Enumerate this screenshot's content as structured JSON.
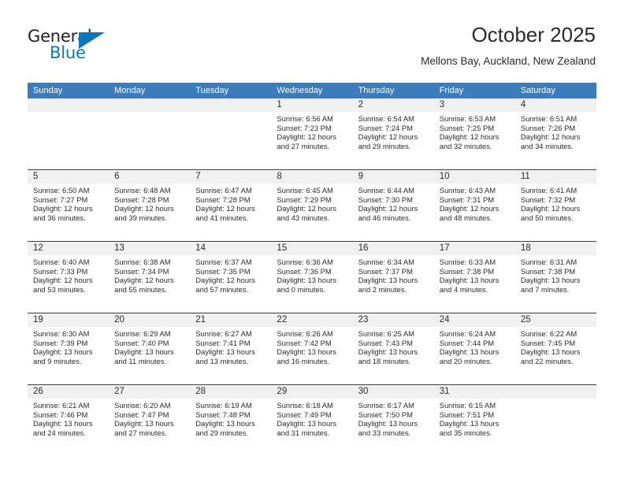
{
  "logo": {
    "primary_text": "General",
    "secondary_text": "Blue",
    "accent_color": "#1175bc"
  },
  "header": {
    "title": "October 2025",
    "subtitle": "Mellons Bay, Auckland, New Zealand"
  },
  "theme": {
    "header_row_color": "#3d7cba",
    "day_band_color": "#f0f0f0",
    "text_color": "#2b2b2b"
  },
  "calendar": {
    "weekdays": [
      "Sunday",
      "Monday",
      "Tuesday",
      "Wednesday",
      "Thursday",
      "Friday",
      "Saturday"
    ],
    "weeks": [
      [
        {
          "day": "",
          "empty": true
        },
        {
          "day": "",
          "empty": true
        },
        {
          "day": "",
          "empty": true
        },
        {
          "day": "1",
          "sunrise": "Sunrise: 6:56 AM",
          "sunset": "Sunset: 7:23 PM",
          "daylight_1": "Daylight: 12 hours",
          "daylight_2": "and 27 minutes."
        },
        {
          "day": "2",
          "sunrise": "Sunrise: 6:54 AM",
          "sunset": "Sunset: 7:24 PM",
          "daylight_1": "Daylight: 12 hours",
          "daylight_2": "and 29 minutes."
        },
        {
          "day": "3",
          "sunrise": "Sunrise: 6:53 AM",
          "sunset": "Sunset: 7:25 PM",
          "daylight_1": "Daylight: 12 hours",
          "daylight_2": "and 32 minutes."
        },
        {
          "day": "4",
          "sunrise": "Sunrise: 6:51 AM",
          "sunset": "Sunset: 7:26 PM",
          "daylight_1": "Daylight: 12 hours",
          "daylight_2": "and 34 minutes."
        }
      ],
      [
        {
          "day": "5",
          "sunrise": "Sunrise: 6:50 AM",
          "sunset": "Sunset: 7:27 PM",
          "daylight_1": "Daylight: 12 hours",
          "daylight_2": "and 36 minutes."
        },
        {
          "day": "6",
          "sunrise": "Sunrise: 6:48 AM",
          "sunset": "Sunset: 7:28 PM",
          "daylight_1": "Daylight: 12 hours",
          "daylight_2": "and 39 minutes."
        },
        {
          "day": "7",
          "sunrise": "Sunrise: 6:47 AM",
          "sunset": "Sunset: 7:28 PM",
          "daylight_1": "Daylight: 12 hours",
          "daylight_2": "and 41 minutes."
        },
        {
          "day": "8",
          "sunrise": "Sunrise: 6:45 AM",
          "sunset": "Sunset: 7:29 PM",
          "daylight_1": "Daylight: 12 hours",
          "daylight_2": "and 43 minutes."
        },
        {
          "day": "9",
          "sunrise": "Sunrise: 6:44 AM",
          "sunset": "Sunset: 7:30 PM",
          "daylight_1": "Daylight: 12 hours",
          "daylight_2": "and 46 minutes."
        },
        {
          "day": "10",
          "sunrise": "Sunrise: 6:43 AM",
          "sunset": "Sunset: 7:31 PM",
          "daylight_1": "Daylight: 12 hours",
          "daylight_2": "and 48 minutes."
        },
        {
          "day": "11",
          "sunrise": "Sunrise: 6:41 AM",
          "sunset": "Sunset: 7:32 PM",
          "daylight_1": "Daylight: 12 hours",
          "daylight_2": "and 50 minutes."
        }
      ],
      [
        {
          "day": "12",
          "sunrise": "Sunrise: 6:40 AM",
          "sunset": "Sunset: 7:33 PM",
          "daylight_1": "Daylight: 12 hours",
          "daylight_2": "and 53 minutes."
        },
        {
          "day": "13",
          "sunrise": "Sunrise: 6:38 AM",
          "sunset": "Sunset: 7:34 PM",
          "daylight_1": "Daylight: 12 hours",
          "daylight_2": "and 55 minutes."
        },
        {
          "day": "14",
          "sunrise": "Sunrise: 6:37 AM",
          "sunset": "Sunset: 7:35 PM",
          "daylight_1": "Daylight: 12 hours",
          "daylight_2": "and 57 minutes."
        },
        {
          "day": "15",
          "sunrise": "Sunrise: 6:36 AM",
          "sunset": "Sunset: 7:36 PM",
          "daylight_1": "Daylight: 13 hours",
          "daylight_2": "and 0 minutes."
        },
        {
          "day": "16",
          "sunrise": "Sunrise: 6:34 AM",
          "sunset": "Sunset: 7:37 PM",
          "daylight_1": "Daylight: 13 hours",
          "daylight_2": "and 2 minutes."
        },
        {
          "day": "17",
          "sunrise": "Sunrise: 6:33 AM",
          "sunset": "Sunset: 7:38 PM",
          "daylight_1": "Daylight: 13 hours",
          "daylight_2": "and 4 minutes."
        },
        {
          "day": "18",
          "sunrise": "Sunrise: 6:31 AM",
          "sunset": "Sunset: 7:38 PM",
          "daylight_1": "Daylight: 13 hours",
          "daylight_2": "and 7 minutes."
        }
      ],
      [
        {
          "day": "19",
          "sunrise": "Sunrise: 6:30 AM",
          "sunset": "Sunset: 7:39 PM",
          "daylight_1": "Daylight: 13 hours",
          "daylight_2": "and 9 minutes."
        },
        {
          "day": "20",
          "sunrise": "Sunrise: 6:29 AM",
          "sunset": "Sunset: 7:40 PM",
          "daylight_1": "Daylight: 13 hours",
          "daylight_2": "and 11 minutes."
        },
        {
          "day": "21",
          "sunrise": "Sunrise: 6:27 AM",
          "sunset": "Sunset: 7:41 PM",
          "daylight_1": "Daylight: 13 hours",
          "daylight_2": "and 13 minutes."
        },
        {
          "day": "22",
          "sunrise": "Sunrise: 6:26 AM",
          "sunset": "Sunset: 7:42 PM",
          "daylight_1": "Daylight: 13 hours",
          "daylight_2": "and 16 minutes."
        },
        {
          "day": "23",
          "sunrise": "Sunrise: 6:25 AM",
          "sunset": "Sunset: 7:43 PM",
          "daylight_1": "Daylight: 13 hours",
          "daylight_2": "and 18 minutes."
        },
        {
          "day": "24",
          "sunrise": "Sunrise: 6:24 AM",
          "sunset": "Sunset: 7:44 PM",
          "daylight_1": "Daylight: 13 hours",
          "daylight_2": "and 20 minutes."
        },
        {
          "day": "25",
          "sunrise": "Sunrise: 6:22 AM",
          "sunset": "Sunset: 7:45 PM",
          "daylight_1": "Daylight: 13 hours",
          "daylight_2": "and 22 minutes."
        }
      ],
      [
        {
          "day": "26",
          "sunrise": "Sunrise: 6:21 AM",
          "sunset": "Sunset: 7:46 PM",
          "daylight_1": "Daylight: 13 hours",
          "daylight_2": "and 24 minutes."
        },
        {
          "day": "27",
          "sunrise": "Sunrise: 6:20 AM",
          "sunset": "Sunset: 7:47 PM",
          "daylight_1": "Daylight: 13 hours",
          "daylight_2": "and 27 minutes."
        },
        {
          "day": "28",
          "sunrise": "Sunrise: 6:19 AM",
          "sunset": "Sunset: 7:48 PM",
          "daylight_1": "Daylight: 13 hours",
          "daylight_2": "and 29 minutes."
        },
        {
          "day": "29",
          "sunrise": "Sunrise: 6:18 AM",
          "sunset": "Sunset: 7:49 PM",
          "daylight_1": "Daylight: 13 hours",
          "daylight_2": "and 31 minutes."
        },
        {
          "day": "30",
          "sunrise": "Sunrise: 6:17 AM",
          "sunset": "Sunset: 7:50 PM",
          "daylight_1": "Daylight: 13 hours",
          "daylight_2": "and 33 minutes."
        },
        {
          "day": "31",
          "sunrise": "Sunrise: 6:15 AM",
          "sunset": "Sunset: 7:51 PM",
          "daylight_1": "Daylight: 13 hours",
          "daylight_2": "and 35 minutes."
        },
        {
          "day": "",
          "empty": true
        }
      ]
    ]
  }
}
